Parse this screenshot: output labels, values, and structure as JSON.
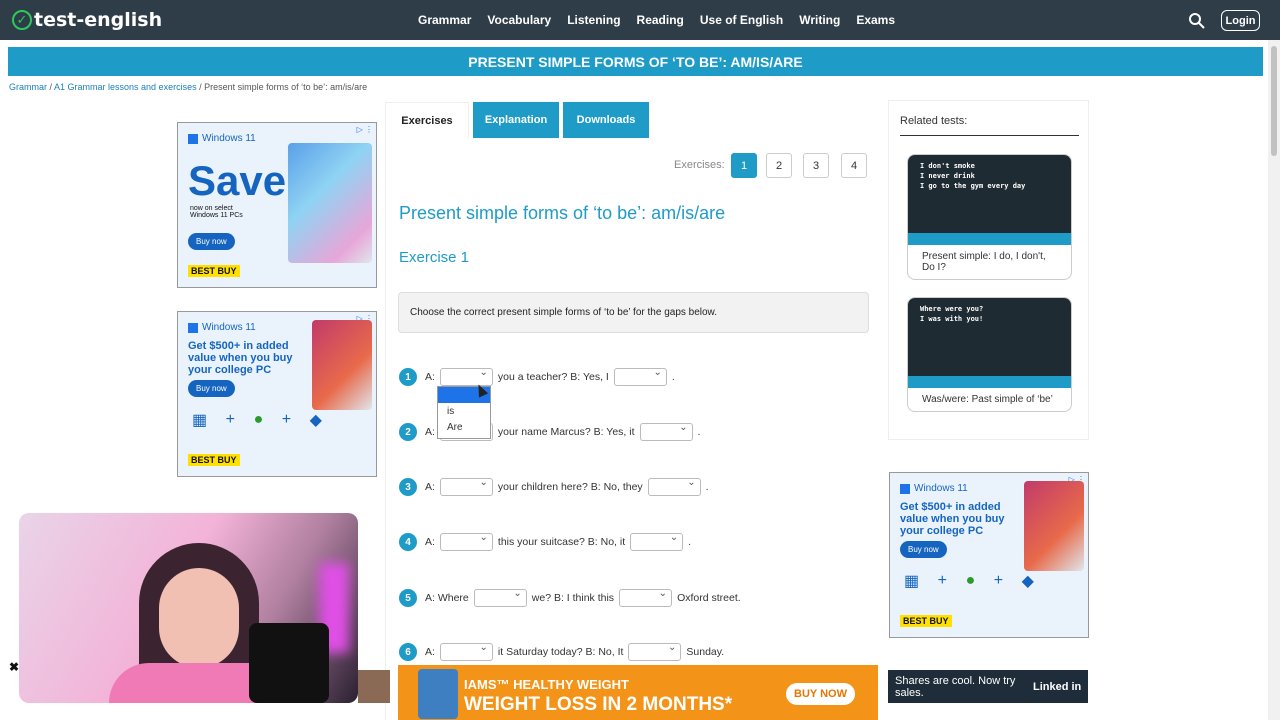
{
  "site": {
    "logo": "test-english",
    "login": "Login"
  },
  "nav": [
    "Grammar",
    "Vocabulary",
    "Listening",
    "Reading",
    "Use of English",
    "Writing",
    "Exams"
  ],
  "banner": "PRESENT SIMPLE FORMS OF ‘TO BE’: AM/IS/ARE",
  "breadcrumb": {
    "c1": "Grammar",
    "sep1": " / ",
    "c2": "A1 Grammar lessons and exercises",
    "sep2": " / ",
    "c3": "Present simple forms of ‘to be’: am/is/are"
  },
  "tabs": {
    "exercises": "Exercises",
    "explanation": "Explanation",
    "downloads": "Downloads"
  },
  "pagination": {
    "label": "Exercises:",
    "pages": [
      "1",
      "2",
      "3",
      "4"
    ],
    "current": "1"
  },
  "main": {
    "title": "Present simple forms of ‘to be’: am/is/are",
    "exercise": "Exercise 1",
    "instruction": "Choose the correct present simple forms of ‘to be’ for the gaps below."
  },
  "questions": [
    {
      "n": "1",
      "a": "A:",
      "mid": "you a teacher? B: Yes, I",
      "end": "."
    },
    {
      "n": "2",
      "a": "A:",
      "mid": "your name Marcus? B: Yes, it",
      "end": "."
    },
    {
      "n": "3",
      "a": "A:",
      "mid": "your children here? B: No, they",
      "end": "."
    },
    {
      "n": "4",
      "a": "A:",
      "mid": "this your suitcase? B: No, it",
      "end": "."
    },
    {
      "n": "5",
      "a": "A: Where",
      "mid": "we? B: I think this",
      "end": "Oxford street."
    },
    {
      "n": "6",
      "a": "A:",
      "mid": "it Saturday today? B: No, It",
      "end": "Sunday."
    }
  ],
  "dropdown": {
    "options": [
      "",
      "is",
      "Are"
    ]
  },
  "related": {
    "title": "Related tests:",
    "cards": [
      {
        "img": "I don't smoke\nI never drink\nI go to the gym every day",
        "caption": "Present simple: I do, I don't, Do I?"
      },
      {
        "img": "Where were you?\nI was with you!",
        "caption": "Was/were: Past simple of ‘be’"
      }
    ]
  },
  "ads": {
    "ad1": {
      "brand": "Windows 11",
      "headline": "Save",
      "sub": "now on select Windows 11 PCs",
      "cta": "Buy now",
      "store": "BEST BUY"
    },
    "ad2": {
      "brand": "Windows 11",
      "headline": "Get $500+ in added value when you buy your college PC",
      "cta": "Buy now",
      "store": "BEST BUY"
    },
    "ad3": {
      "brand": "Windows 11",
      "headline": "Get $500+ in added value when you buy your college PC",
      "cta": "Buy now",
      "store": "BEST BUY"
    },
    "bottom": {
      "brand": "IAMS™ HEALTHY WEIGHT",
      "headline": "WEIGHT LOSS IN 2 MONTHS*",
      "cta": "BUY NOW"
    },
    "linkedin": {
      "text": "Shares are cool. Now try sales.",
      "brand": "Linked in"
    }
  },
  "colors": {
    "accent": "#1e9bc7",
    "topbar": "#2f3d48",
    "ad_orange": "#f39419"
  }
}
